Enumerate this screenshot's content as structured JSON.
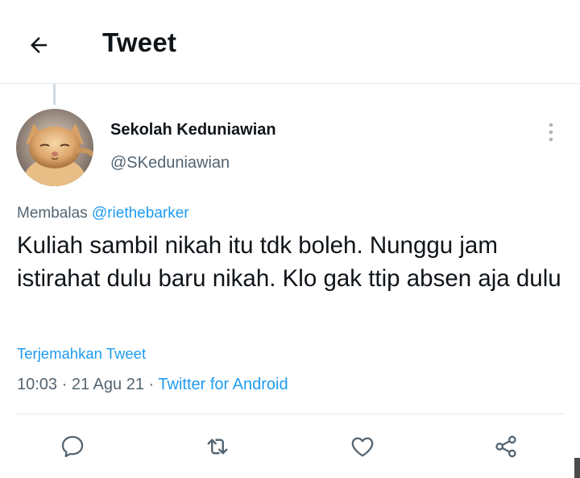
{
  "header": {
    "title": "Tweet",
    "back_icon": "arrow-left-icon"
  },
  "tweet": {
    "author": {
      "display_name": "Sekolah Keduniawian",
      "handle": "@SKeduniawian",
      "avatar": "kitten-avatar"
    },
    "reply": {
      "prefix": "Membalas",
      "mention": "@riethebarker"
    },
    "text": "Kuliah sambil nikah itu tdk boleh. Nunggu jam istirahat dulu baru nikah. Klo gak ttip absen aja dulu",
    "translate_label": "Terjemahkan Tweet",
    "time": "10:03",
    "sep1": "·",
    "date": "21 Agu 21",
    "sep2": "·",
    "source": "Twitter for Android"
  },
  "actions": [
    {
      "name": "reply",
      "icon": "speech-bubble-icon"
    },
    {
      "name": "retweet",
      "icon": "retweet-icon"
    },
    {
      "name": "like",
      "icon": "heart-icon"
    },
    {
      "name": "share",
      "icon": "share-icon"
    }
  ],
  "colors": {
    "link": "#1d9bf0",
    "text": "#0f1419",
    "secondary": "#536471",
    "divider": "#e6e9ec"
  }
}
